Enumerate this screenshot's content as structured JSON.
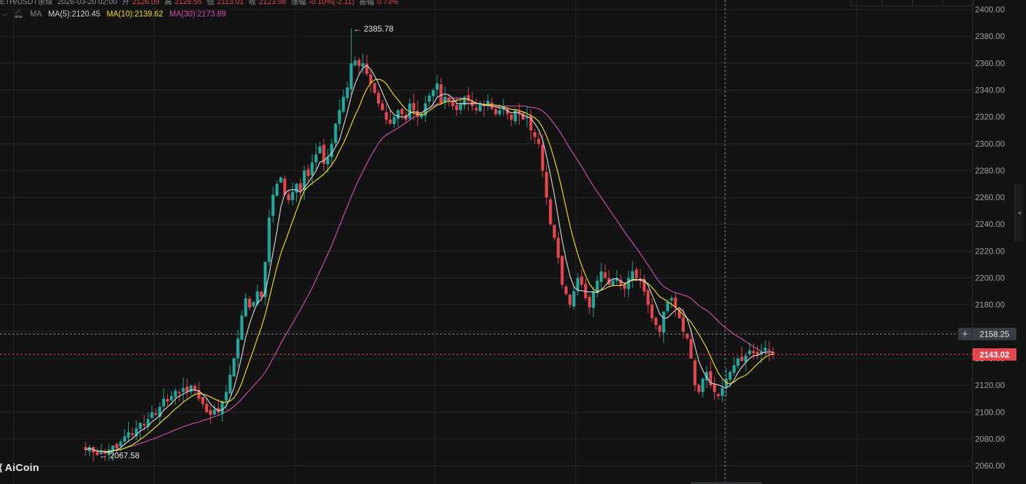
{
  "header": {
    "symbol": "ETH/USDT永续",
    "datetime": "2026-03-20 02:00",
    "open_label": "开",
    "open": "2126.09",
    "high_label": "高",
    "high": "2128.55",
    "low_label": "低",
    "low": "2113.01",
    "close_label": "收",
    "close": "2123.98",
    "change_label": "涨幅",
    "change": "-0.10%(-2.11)",
    "amp_label": "振幅",
    "amp": "0.73%"
  },
  "ma_legend": {
    "indicator": "MA",
    "ma5": "MA(5):2120.45",
    "ma10": "MA(10):2139.62",
    "ma30": "MA(30):2173.89"
  },
  "price_tags": {
    "crosshair": "2158.25",
    "last": "2143.02",
    "high_marker": "← 2385.78",
    "low_marker": "← 2067.58"
  },
  "logo": {
    "text": "AiCoin",
    "icon": "aicoin-logo-icon"
  },
  "colors": {
    "up": "#26a69a",
    "down": "#e0474f",
    "ma5": "#d6d6d6",
    "ma10": "#f2df2f",
    "ma30": "#d24fb2",
    "background": "#131314",
    "grid": "#25262a"
  },
  "chart_data": {
    "type": "candlestick",
    "y_ticks": [
      "2400.00",
      "2380.00",
      "2360.00",
      "2340.00",
      "2320.00",
      "2300.00",
      "2280.00",
      "2260.00",
      "2240.00",
      "2220.00",
      "2200.00",
      "2180.00",
      "2160.00",
      "2140.00",
      "2120.00",
      "2100.00",
      "2080.00",
      "2060.00"
    ],
    "ylim": [
      2055,
      2402
    ],
    "crosshair_price": 2158.25,
    "last_price": 2143.02,
    "high_mark": 2385.78,
    "low_mark": 2067.58,
    "closes": [
      2072,
      2074,
      2070,
      2068,
      2071,
      2069,
      2072,
      2075,
      2073,
      2078,
      2082,
      2085,
      2083,
      2088,
      2092,
      2090,
      2095,
      2100,
      2098,
      2104,
      2110,
      2108,
      2112,
      2116,
      2114,
      2118,
      2115,
      2120,
      2116,
      2110,
      2106,
      2100,
      2098,
      2102,
      2100,
      2108,
      2115,
      2128,
      2140,
      2155,
      2172,
      2185,
      2178,
      2182,
      2190,
      2186,
      2212,
      2245,
      2262,
      2270,
      2275,
      2262,
      2258,
      2264,
      2270,
      2265,
      2280,
      2276,
      2286,
      2292,
      2298,
      2285,
      2290,
      2300,
      2315,
      2325,
      2335,
      2342,
      2360,
      2362,
      2358,
      2360,
      2352,
      2345,
      2338,
      2330,
      2325,
      2318,
      2315,
      2320,
      2325,
      2322,
      2318,
      2330,
      2325,
      2320,
      2322,
      2330,
      2336,
      2340,
      2345,
      2330,
      2335,
      2332,
      2328,
      2325,
      2330,
      2335,
      2332,
      2328,
      2325,
      2330,
      2328,
      2332,
      2326,
      2322,
      2325,
      2328,
      2322,
      2318,
      2325,
      2322,
      2318,
      2320,
      2310,
      2305,
      2300,
      2280,
      2260,
      2240,
      2230,
      2215,
      2195,
      2188,
      2180,
      2190,
      2200,
      2195,
      2185,
      2178,
      2190,
      2198,
      2205,
      2200,
      2195,
      2198,
      2200,
      2195,
      2192,
      2200,
      2205,
      2200,
      2198,
      2190,
      2180,
      2170,
      2165,
      2160,
      2175,
      2182,
      2185,
      2178,
      2170,
      2160,
      2155,
      2140,
      2120,
      2115,
      2125,
      2130,
      2120,
      2115,
      2112,
      2118,
      2125,
      2130,
      2135,
      2140,
      2138,
      2142,
      2146,
      2144,
      2142,
      2145,
      2148,
      2146,
      2143
    ],
    "ma_series": [
      "MA(5)",
      "MA(10)",
      "MA(30)"
    ]
  }
}
